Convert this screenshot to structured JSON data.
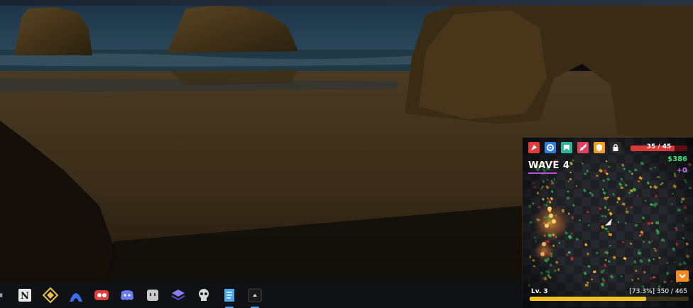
{
  "taskbar": {
    "icons": [
      {
        "name": "app-icon"
      },
      {
        "name": "notion-icon",
        "glyph": "N"
      },
      {
        "name": "diamond-app-icon"
      },
      {
        "name": "arch-app-icon"
      },
      {
        "name": "recorder-icon"
      },
      {
        "name": "discord-icon"
      },
      {
        "name": "robot-app-icon"
      },
      {
        "name": "stack-app-icon"
      },
      {
        "name": "skull-app-icon"
      },
      {
        "name": "notepad-icon"
      },
      {
        "name": "game-window-icon"
      }
    ]
  },
  "game": {
    "health": {
      "text": "35 / 45",
      "current": 35,
      "max": 45,
      "color": "#d83a3a"
    },
    "wave_label": "WAVE 4",
    "money": "$386",
    "gain": "+0",
    "level": "Lv. 3",
    "xp": {
      "text": "[73.3%] 350 / 465",
      "fraction": 0.733,
      "color": "#f2c21e"
    },
    "upgrades": [
      {
        "name": "rocket-upgrade-icon",
        "color": "#e23b3b"
      },
      {
        "name": "gear-upgrade-icon",
        "color": "#2f7ee8"
      },
      {
        "name": "banner-upgrade-icon",
        "color": "#2fb59a"
      },
      {
        "name": "blade-upgrade-icon",
        "color": "#e0405a"
      },
      {
        "name": "shield-upgrade-icon",
        "color": "#f0a020"
      },
      {
        "name": "lock-upgrade-icon",
        "color": "#2a2a2a"
      }
    ],
    "menu_button_icon": "chevron-down-icon"
  }
}
